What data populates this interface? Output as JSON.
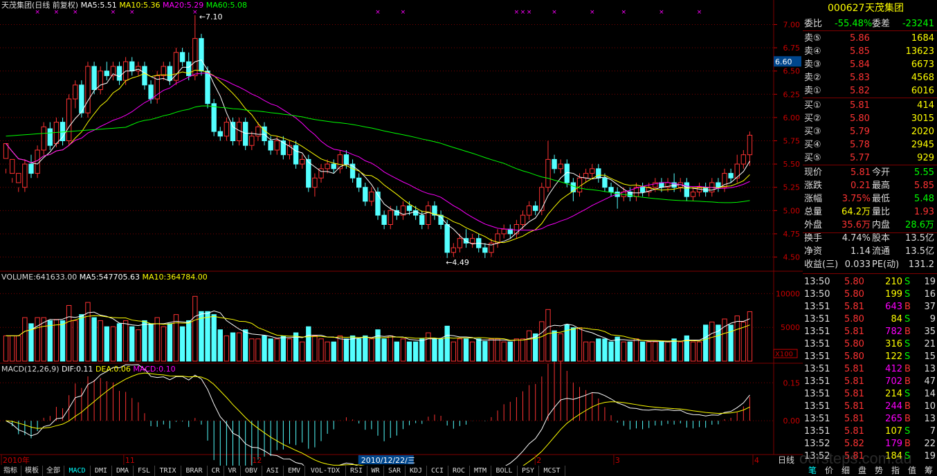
{
  "header": {
    "title": "天茂集团(日线 前复权)",
    "ma5": "MA5:5.51",
    "ma10": "MA10:5.36",
    "ma20": "MA20:5.29",
    "ma60": "MA60:5.08"
  },
  "volume_header": {
    "vol": "VOLUME:641633.00",
    "ma5": "MA5:547705.63",
    "ma10": "MA10:364784.00"
  },
  "macd_header": {
    "name": "MACD(12,26,9)",
    "dif": "DIF:0.11",
    "dea": "DEA:0.06",
    "macd": "MACD:0.10"
  },
  "price_axis": [
    "7.00",
    "6.75",
    "6.50",
    "6.25",
    "6.00",
    "5.75",
    "5.50",
    "5.25",
    "5.00",
    "4.75",
    "4.50"
  ],
  "price_marker": "6.60",
  "high_label": "7.10",
  "low_label": "4.49",
  "volume_axis": [
    "10000",
    "5000"
  ],
  "volume_unit": "X100",
  "macd_axis": [
    "0.15",
    "0.00"
  ],
  "date_labels": [
    "2010年",
    "11",
    "12",
    "2010/12/22/三",
    "2",
    "3",
    "4"
  ],
  "period_label": "日线",
  "colors": {
    "up": "#ff3232",
    "down": "#54ffff",
    "ma5": "#ffffff",
    "ma10": "#ffff00",
    "ma20": "#ff00ff",
    "ma60": "#00ff00",
    "grid": "#800000"
  },
  "quote": {
    "code": "000627",
    "name": "天茂集团",
    "weibi_label": "委比",
    "weibi": "-55.48%",
    "weicha_label": "委差",
    "weicha": "-23241",
    "asks": [
      {
        "label": "卖⑤",
        "price": "5.86",
        "vol": "1684"
      },
      {
        "label": "卖④",
        "price": "5.85",
        "vol": "13623"
      },
      {
        "label": "卖③",
        "price": "5.84",
        "vol": "6673"
      },
      {
        "label": "卖②",
        "price": "5.83",
        "vol": "4568"
      },
      {
        "label": "卖①",
        "price": "5.82",
        "vol": "6016"
      }
    ],
    "bids": [
      {
        "label": "买①",
        "price": "5.81",
        "vol": "414"
      },
      {
        "label": "买②",
        "price": "5.80",
        "vol": "3015"
      },
      {
        "label": "买③",
        "price": "5.79",
        "vol": "2020"
      },
      {
        "label": "买④",
        "price": "5.78",
        "vol": "2945"
      },
      {
        "label": "买⑤",
        "price": "5.77",
        "vol": "929"
      }
    ],
    "stats": [
      {
        "l1": "现价",
        "v1": "5.81",
        "l2": "今开",
        "v2": "5.55"
      },
      {
        "l1": "涨跌",
        "v1": "0.21",
        "l2": "最高",
        "v2": "5.85"
      },
      {
        "l1": "涨幅",
        "v1": "3.75%",
        "l2": "最低",
        "v2": "5.48"
      },
      {
        "l1": "总量",
        "v1": "64.2万",
        "l2": "量比",
        "v2": "1.93"
      },
      {
        "l1": "外盘",
        "v1": "35.6万",
        "l2": "内盘",
        "v2": "28.6万"
      },
      {
        "l1": "换手",
        "v1": "4.74%",
        "l2": "股本",
        "v2": "13.5亿"
      },
      {
        "l1": "净资",
        "v1": "1.14",
        "l2": "流通",
        "v2": "13.5亿"
      },
      {
        "l1": "收益(三)",
        "v1": "0.033",
        "l2": "PE(动)",
        "v2": "131.2"
      }
    ]
  },
  "ticks": [
    {
      "time": "13:50",
      "price": "5.80",
      "vol": "210",
      "bs": "S",
      "n": "19"
    },
    {
      "time": "13:50",
      "price": "5.80",
      "vol": "199",
      "bs": "S",
      "n": "16"
    },
    {
      "time": "13:51",
      "price": "5.81",
      "vol": "643",
      "bs": "B",
      "n": "37"
    },
    {
      "time": "13:51",
      "price": "5.80",
      "vol": "84",
      "bs": "S",
      "n": "9"
    },
    {
      "time": "13:51",
      "price": "5.81",
      "vol": "782",
      "bs": "B",
      "n": "35"
    },
    {
      "time": "13:51",
      "price": "5.80",
      "vol": "316",
      "bs": "S",
      "n": "21"
    },
    {
      "time": "13:51",
      "price": "5.80",
      "vol": "122",
      "bs": "S",
      "n": "15"
    },
    {
      "time": "13:51",
      "price": "5.81",
      "vol": "412",
      "bs": "B",
      "n": "13"
    },
    {
      "time": "13:51",
      "price": "5.81",
      "vol": "702",
      "bs": "B",
      "n": "47"
    },
    {
      "time": "13:51",
      "price": "5.81",
      "vol": "214",
      "bs": "S",
      "n": "14"
    },
    {
      "time": "13:51",
      "price": "5.81",
      "vol": "244",
      "bs": "B",
      "n": "10"
    },
    {
      "time": "13:51",
      "price": "5.81",
      "vol": "265",
      "bs": "B",
      "n": "13"
    },
    {
      "time": "13:51",
      "price": "5.81",
      "vol": "107",
      "bs": "S",
      "n": "7"
    },
    {
      "time": "13:52",
      "price": "5.82",
      "vol": "179",
      "bs": "B",
      "n": "22"
    },
    {
      "time": "13:52",
      "price": "5.81",
      "vol": "184",
      "bs": "S",
      "n": "19"
    }
  ],
  "indicator_tabs": [
    "指标",
    "模板",
    "全部",
    "MACD",
    "DMI",
    "DMA",
    "FSL",
    "TRIX",
    "BRAR",
    "CR",
    "VR",
    "OBV",
    "ASI",
    "EMV",
    "VOL-TDX",
    "RSI",
    "WR",
    "SAR",
    "KDJ",
    "CCI",
    "ROC",
    "MTM",
    "BOLL",
    "PSY",
    "MCST"
  ],
  "active_tab": "MACD",
  "bottom_right_tabs": [
    "笔",
    "价",
    "细",
    "盘",
    "势",
    "指",
    "值",
    "筹"
  ],
  "watermark": "oursteps.com.au",
  "chart_data": {
    "type": "candlestick",
    "candles": [
      [
        5.56,
        5.72,
        5.45,
        5.4
      ],
      [
        5.4,
        5.55,
        5.35,
        5.3
      ],
      [
        5.3,
        5.4,
        5.25,
        5.2
      ],
      [
        5.25,
        5.5,
        5.55,
        5.2
      ],
      [
        5.5,
        5.4,
        5.6,
        5.35
      ],
      [
        5.4,
        5.65,
        5.7,
        5.35
      ],
      [
        5.65,
        5.9,
        5.95,
        5.6
      ],
      [
        5.88,
        5.7,
        5.95,
        5.65
      ],
      [
        5.72,
        5.95,
        6.0,
        5.68
      ],
      [
        5.95,
        5.75,
        6.0,
        5.7
      ],
      [
        5.75,
        6.2,
        6.25,
        5.7
      ],
      [
        6.2,
        6.35,
        6.4,
        6.1
      ],
      [
        6.35,
        6.05,
        6.4,
        6.0
      ],
      [
        6.05,
        6.55,
        6.6,
        6.0
      ],
      [
        6.55,
        6.3,
        6.6,
        6.25
      ],
      [
        6.3,
        6.5,
        6.55,
        6.25
      ],
      [
        6.5,
        6.45,
        6.6,
        6.4
      ],
      [
        6.45,
        6.55,
        6.6,
        6.4
      ],
      [
        6.55,
        6.4,
        6.6,
        6.35
      ],
      [
        6.4,
        6.6,
        6.65,
        6.35
      ],
      [
        6.6,
        6.5,
        6.65,
        6.45
      ],
      [
        6.5,
        6.55,
        6.6,
        6.45
      ],
      [
        6.55,
        6.35,
        6.6,
        6.3
      ],
      [
        6.35,
        6.2,
        6.4,
        6.15
      ],
      [
        6.2,
        6.45,
        6.5,
        6.15
      ],
      [
        6.45,
        6.55,
        6.6,
        6.4
      ],
      [
        6.55,
        6.4,
        6.6,
        6.35
      ],
      [
        6.4,
        6.7,
        6.75,
        6.35
      ],
      [
        6.7,
        6.6,
        6.75,
        6.55
      ],
      [
        6.6,
        6.45,
        6.7,
        6.4
      ],
      [
        6.45,
        6.85,
        7.1,
        6.4
      ],
      [
        6.85,
        6.5,
        6.9,
        6.45
      ],
      [
        6.5,
        6.15,
        6.55,
        6.1
      ],
      [
        6.15,
        5.85,
        6.2,
        5.8
      ],
      [
        5.85,
        5.8,
        5.9,
        5.75
      ],
      [
        5.8,
        5.95,
        6.0,
        5.75
      ],
      [
        5.95,
        5.75,
        6.0,
        5.7
      ],
      [
        5.75,
        5.95,
        6.0,
        5.7
      ],
      [
        5.95,
        5.7,
        6.0,
        5.65
      ],
      [
        5.7,
        5.8,
        5.85,
        5.65
      ],
      [
        5.8,
        5.9,
        5.95,
        5.75
      ],
      [
        5.9,
        5.75,
        5.95,
        5.7
      ],
      [
        5.75,
        5.65,
        5.8,
        5.6
      ],
      [
        5.65,
        5.75,
        5.8,
        5.6
      ],
      [
        5.75,
        5.6,
        5.8,
        5.55
      ],
      [
        5.6,
        5.7,
        5.75,
        5.55
      ],
      [
        5.7,
        5.5,
        5.75,
        5.45
      ],
      [
        5.5,
        5.55,
        5.6,
        5.45
      ],
      [
        5.55,
        5.25,
        5.6,
        5.2
      ],
      [
        5.25,
        5.35,
        5.4,
        5.15
      ],
      [
        5.35,
        5.45,
        5.5,
        5.3
      ],
      [
        5.45,
        5.5,
        5.55,
        5.4
      ],
      [
        5.5,
        5.45,
        5.55,
        5.4
      ],
      [
        5.45,
        5.6,
        5.65,
        5.4
      ],
      [
        5.6,
        5.5,
        5.65,
        5.45
      ],
      [
        5.5,
        5.35,
        5.55,
        5.3
      ],
      [
        5.35,
        5.25,
        5.4,
        5.2
      ],
      [
        5.25,
        5.1,
        5.3,
        5.05
      ],
      [
        5.1,
        5.2,
        5.25,
        5.05
      ],
      [
        5.2,
        4.95,
        5.25,
        4.9
      ],
      [
        4.95,
        4.85,
        5.0,
        4.8
      ],
      [
        4.85,
        5.0,
        5.05,
        4.8
      ],
      [
        5.0,
        4.95,
        5.05,
        4.9
      ],
      [
        4.95,
        5.05,
        5.1,
        4.9
      ],
      [
        5.05,
        5.0,
        5.1,
        4.95
      ],
      [
        5.0,
        4.95,
        5.05,
        4.9
      ],
      [
        4.95,
        4.85,
        5.0,
        4.8
      ],
      [
        4.85,
        5.05,
        5.1,
        4.8
      ],
      [
        5.05,
        4.95,
        5.1,
        4.9
      ],
      [
        4.95,
        4.85,
        5.0,
        4.8
      ],
      [
        4.85,
        4.55,
        4.9,
        4.49
      ],
      [
        4.55,
        4.6,
        4.65,
        4.5
      ],
      [
        4.6,
        4.7,
        4.75,
        4.55
      ],
      [
        4.7,
        4.65,
        4.8,
        4.6
      ],
      [
        4.65,
        4.7,
        4.75,
        4.6
      ],
      [
        4.7,
        4.6,
        4.75,
        4.55
      ],
      [
        4.6,
        4.55,
        4.65,
        4.49
      ],
      [
        4.55,
        4.65,
        4.7,
        4.5
      ],
      [
        4.65,
        4.75,
        4.8,
        4.6
      ],
      [
        4.75,
        4.8,
        4.85,
        4.7
      ],
      [
        4.8,
        4.75,
        4.85,
        4.7
      ],
      [
        4.75,
        4.85,
        4.9,
        4.7
      ],
      [
        4.85,
        4.95,
        5.0,
        4.8
      ],
      [
        4.95,
        5.05,
        5.1,
        4.9
      ],
      [
        5.05,
        5.0,
        5.1,
        4.95
      ],
      [
        5.0,
        5.25,
        5.3,
        4.95
      ],
      [
        5.25,
        5.55,
        5.75,
        5.2
      ],
      [
        5.55,
        5.45,
        5.6,
        5.4
      ],
      [
        5.45,
        5.5,
        5.55,
        5.4
      ],
      [
        5.5,
        5.3,
        5.55,
        5.25
      ],
      [
        5.3,
        5.2,
        5.35,
        5.1
      ],
      [
        5.2,
        5.35,
        5.4,
        5.15
      ],
      [
        5.35,
        5.4,
        5.45,
        5.3
      ],
      [
        5.4,
        5.45,
        5.5,
        5.35
      ],
      [
        5.45,
        5.35,
        5.5,
        5.3
      ],
      [
        5.35,
        5.25,
        5.4,
        5.2
      ],
      [
        5.25,
        5.2,
        5.3,
        5.15
      ],
      [
        5.2,
        5.15,
        5.25,
        5.02
      ],
      [
        5.15,
        5.2,
        5.25,
        5.1
      ],
      [
        5.2,
        5.15,
        5.25,
        5.1
      ],
      [
        5.15,
        5.25,
        5.3,
        5.1
      ],
      [
        5.25,
        5.2,
        5.3,
        5.15
      ],
      [
        5.2,
        5.25,
        5.3,
        5.15
      ],
      [
        5.25,
        5.3,
        5.35,
        5.2
      ],
      [
        5.3,
        5.25,
        5.35,
        5.2
      ],
      [
        5.25,
        5.3,
        5.35,
        5.2
      ],
      [
        5.3,
        5.25,
        5.4,
        5.2
      ],
      [
        5.25,
        5.3,
        5.35,
        5.2
      ],
      [
        5.3,
        5.15,
        5.35,
        5.1
      ],
      [
        5.15,
        5.2,
        5.25,
        5.1
      ],
      [
        5.2,
        5.25,
        5.3,
        5.15
      ],
      [
        5.25,
        5.2,
        5.3,
        5.15
      ],
      [
        5.2,
        5.3,
        5.35,
        5.15
      ],
      [
        5.3,
        5.25,
        5.35,
        5.2
      ],
      [
        5.25,
        5.4,
        5.45,
        5.2
      ],
      [
        5.4,
        5.35,
        5.45,
        5.3
      ],
      [
        5.35,
        5.5,
        5.6,
        5.3
      ],
      [
        5.5,
        5.6,
        5.65,
        5.45
      ],
      [
        5.6,
        5.81,
        5.85,
        5.48
      ]
    ]
  }
}
